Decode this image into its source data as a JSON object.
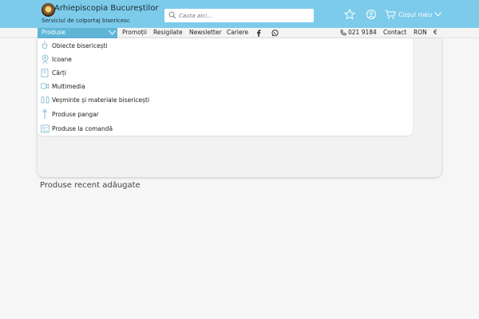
{
  "header": {
    "brand_title": "Arhiepiscopia Bucureștilor",
    "brand_subtitle": "Serviciul de colportaj bisericesc",
    "search_placeholder": "Cauta aici...",
    "cart_label": "Coșul meu",
    "colors": {
      "header_bg": "#7ccbea",
      "active_nav": "#5fb5d6"
    }
  },
  "nav": {
    "products_label": "Produse",
    "links": [
      "Promoții",
      "Resigilate",
      "Newsletter",
      "Cariere"
    ],
    "phone": "021 9184",
    "contact": "Contact",
    "currency": "RON",
    "currency_symbol": "€"
  },
  "menu": {
    "items": [
      {
        "label": "Obiecte bisericești",
        "icon": "censer-icon"
      },
      {
        "label": "Icoane",
        "icon": "icon-portrait-icon"
      },
      {
        "label": "Cărți",
        "icon": "book-icon"
      },
      {
        "label": "Multimedia",
        "icon": "media-icon"
      },
      {
        "label": "Veșminte și materiale bisericești",
        "icon": "vestments-icon"
      },
      {
        "label": "Produse pangar",
        "icon": "candle-icon"
      },
      {
        "label": "Produse la comandă",
        "icon": "order-icon"
      }
    ]
  },
  "main": {
    "recent_title": "Produse recent adăugate"
  }
}
